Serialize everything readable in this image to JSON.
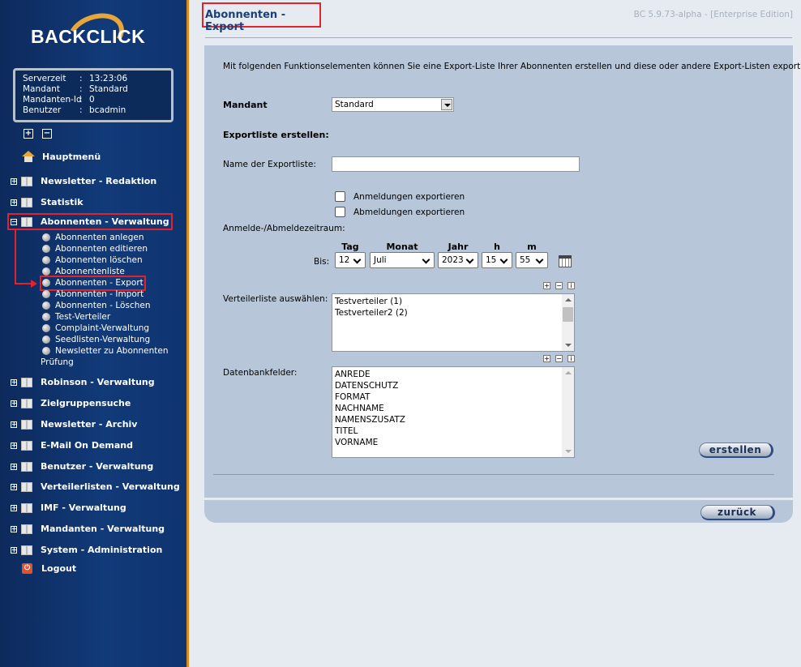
{
  "app": {
    "logo_text": "BACKCLICK",
    "version": "BC 5.9.73-alpha - [Enterprise Edition]"
  },
  "info": [
    {
      "key": "Serverzeit",
      "sep": ":",
      "value": "13:23:06"
    },
    {
      "key": "Mandant",
      "sep": ":",
      "value": "Standard"
    },
    {
      "key": "Mandanten-Id",
      "sep": ":",
      "value": "0"
    },
    {
      "key": "Benutzer",
      "sep": ":",
      "value": "bcadmin"
    }
  ],
  "tree_toggles": {
    "expand": "+",
    "collapse": "−"
  },
  "nav": {
    "home": "Hauptmenü",
    "newsletter_redaktion": "Newsletter - Redaktion",
    "statistik": "Statistik",
    "abonnenten_verwaltung": "Abonnenten - Verwaltung",
    "sub": [
      "Abonnenten anlegen",
      "Abonnenten editieren",
      "Abonnenten löschen",
      "Abonnentenliste",
      "Abonnenten - Export",
      "Abonnenten - Import",
      "Abonnenten - Löschen",
      "Test-Verteiler",
      "Complaint-Verwaltung",
      "Seedlisten-Verwaltung",
      "Newsletter zu Abonnenten",
      "Prüfung"
    ],
    "robinson": "Robinson - Verwaltung",
    "zielgruppensuche": "Zielgruppensuche",
    "newsletter_archiv": "Newsletter - Archiv",
    "email_on_demand": "E-Mail On Demand",
    "benutzer": "Benutzer - Verwaltung",
    "verteilerlisten": "Verteilerlisten - Verwaltung",
    "imf": "IMF - Verwaltung",
    "mandanten": "Mandanten - Verwaltung",
    "system": "System - Administration",
    "logout": "Logout",
    "logout_icon": "⏻",
    "plus": "+",
    "minus": "−"
  },
  "page": {
    "title": "Abonnenten - Export",
    "intro": "Mit folgenden Funktionselementen können Sie eine Export-Liste Ihrer Abonnenten erstellen und diese oder andere Export-Listen exportieren.",
    "mandant_label": "Mandant",
    "mandant_value": "Standard",
    "exportliste_heading": "Exportliste erstellen:",
    "name_label": "Name der Exportliste:",
    "name_value": "",
    "anmeldungen_label": "Anmeldungen exportieren",
    "abmeldungen_label": "Abmeldungen exportieren",
    "zeitraum_label": "Anmelde-/Abmeldezeitraum:",
    "date_headers": {
      "tag": "Tag",
      "monat": "Monat",
      "jahr": "Jahr",
      "h": "h",
      "m": "m"
    },
    "bis_label": "Bis:",
    "date_values": {
      "tag": "12",
      "monat": "Juli",
      "jahr": "2023",
      "h": "15",
      "m": "55"
    },
    "verteiler_label": "Verteilerliste auswählen:",
    "verteiler_items": [
      "Testverteiler (1)",
      "Testverteiler2 (2)"
    ],
    "datenbank_label": "Datenbankfelder:",
    "datenbank_items": [
      "ANREDE",
      "DATENSCHUTZ",
      "FORMAT",
      "NACHNAME",
      "NAMENSZUSATZ",
      "TITEL",
      "VORNAME"
    ],
    "mini_icons": {
      "plus": "+",
      "minus": "−",
      "info": "i"
    },
    "erstellen_button": "erstellen",
    "zurueck_button": "zurück"
  }
}
